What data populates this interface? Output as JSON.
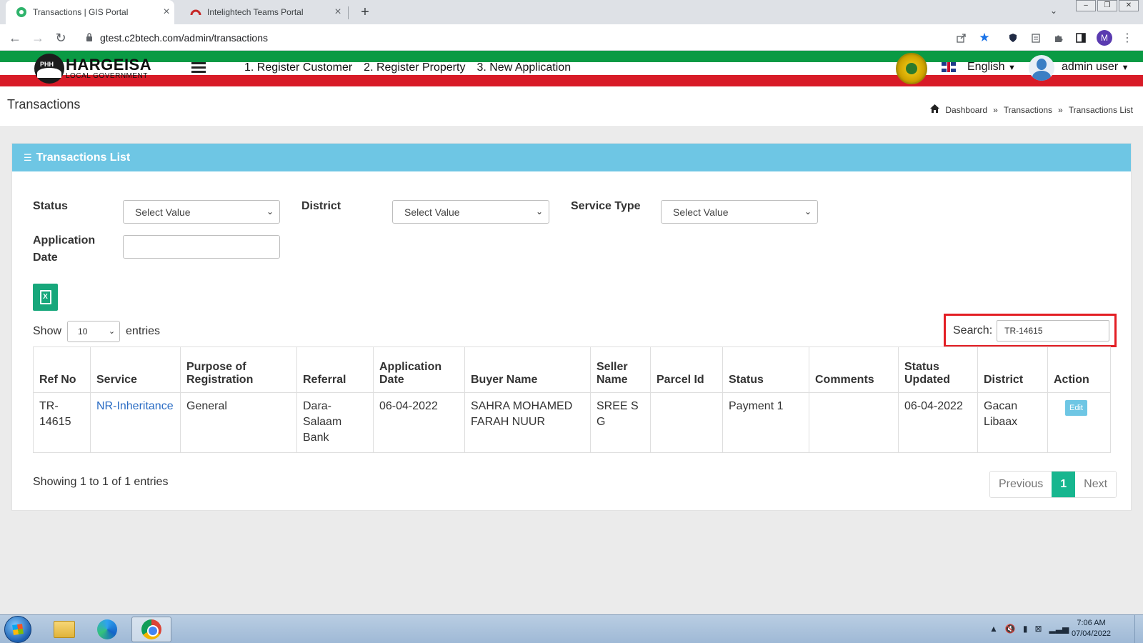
{
  "browser": {
    "tabs": [
      {
        "title": "Transactions | GIS Portal",
        "active": true
      },
      {
        "title": "Intelightech Teams Portal",
        "active": false
      }
    ],
    "new_tab_symbol": "+",
    "url": "gtest.c2btech.com/admin/transactions",
    "profile_initial": "M"
  },
  "header": {
    "logo_title": "HARGEISA",
    "logo_subtitle": "LOCAL GOVERNMENT",
    "nav": [
      "1. Register Customer",
      "2. Register Property",
      "3. New Application"
    ],
    "language": "English",
    "user": "admin user"
  },
  "page": {
    "title": "Transactions",
    "breadcrumbs": [
      "Dashboard",
      "Transactions",
      "Transactions List"
    ],
    "breadcrumb_separator": "»"
  },
  "card": {
    "title": "Transactions List",
    "filters": {
      "status_label": "Status",
      "status_value": "Select Value",
      "district_label": "District",
      "district_value": "Select Value",
      "service_type_label": "Service Type",
      "service_type_value": "Select Value",
      "application_date_label": "Application Date",
      "application_date_value": ""
    },
    "length": {
      "show": "Show",
      "value": "10",
      "entries": "entries"
    },
    "search": {
      "label": "Search:",
      "value": "TR-14615"
    },
    "table": {
      "columns": [
        "Ref No",
        "Service",
        "Purpose of Registration",
        "Referral",
        "Application Date",
        "Buyer Name",
        "Seller Name",
        "Parcel Id",
        "Status",
        "Comments",
        "Status Updated",
        "District",
        "Action"
      ],
      "rows": [
        {
          "ref_no": "TR-14615",
          "service": "NR-Inheritance",
          "purpose": "General",
          "referral": "Dara-Salaam Bank",
          "application_date": "06-04-2022",
          "buyer_name": "SAHRA MOHAMED FARAH NUUR",
          "seller_name": "SREE S G",
          "parcel_id": "",
          "status": "Payment 1",
          "comments": "",
          "status_updated": "06-04-2022",
          "district": "Gacan Libaax",
          "action": "Edit"
        }
      ]
    },
    "info": "Showing 1 to 1 of 1 entries",
    "pagination": {
      "previous": "Previous",
      "current": "1",
      "next": "Next"
    }
  },
  "taskbar": {
    "time": "7:06 AM",
    "date": "07/04/2022"
  }
}
